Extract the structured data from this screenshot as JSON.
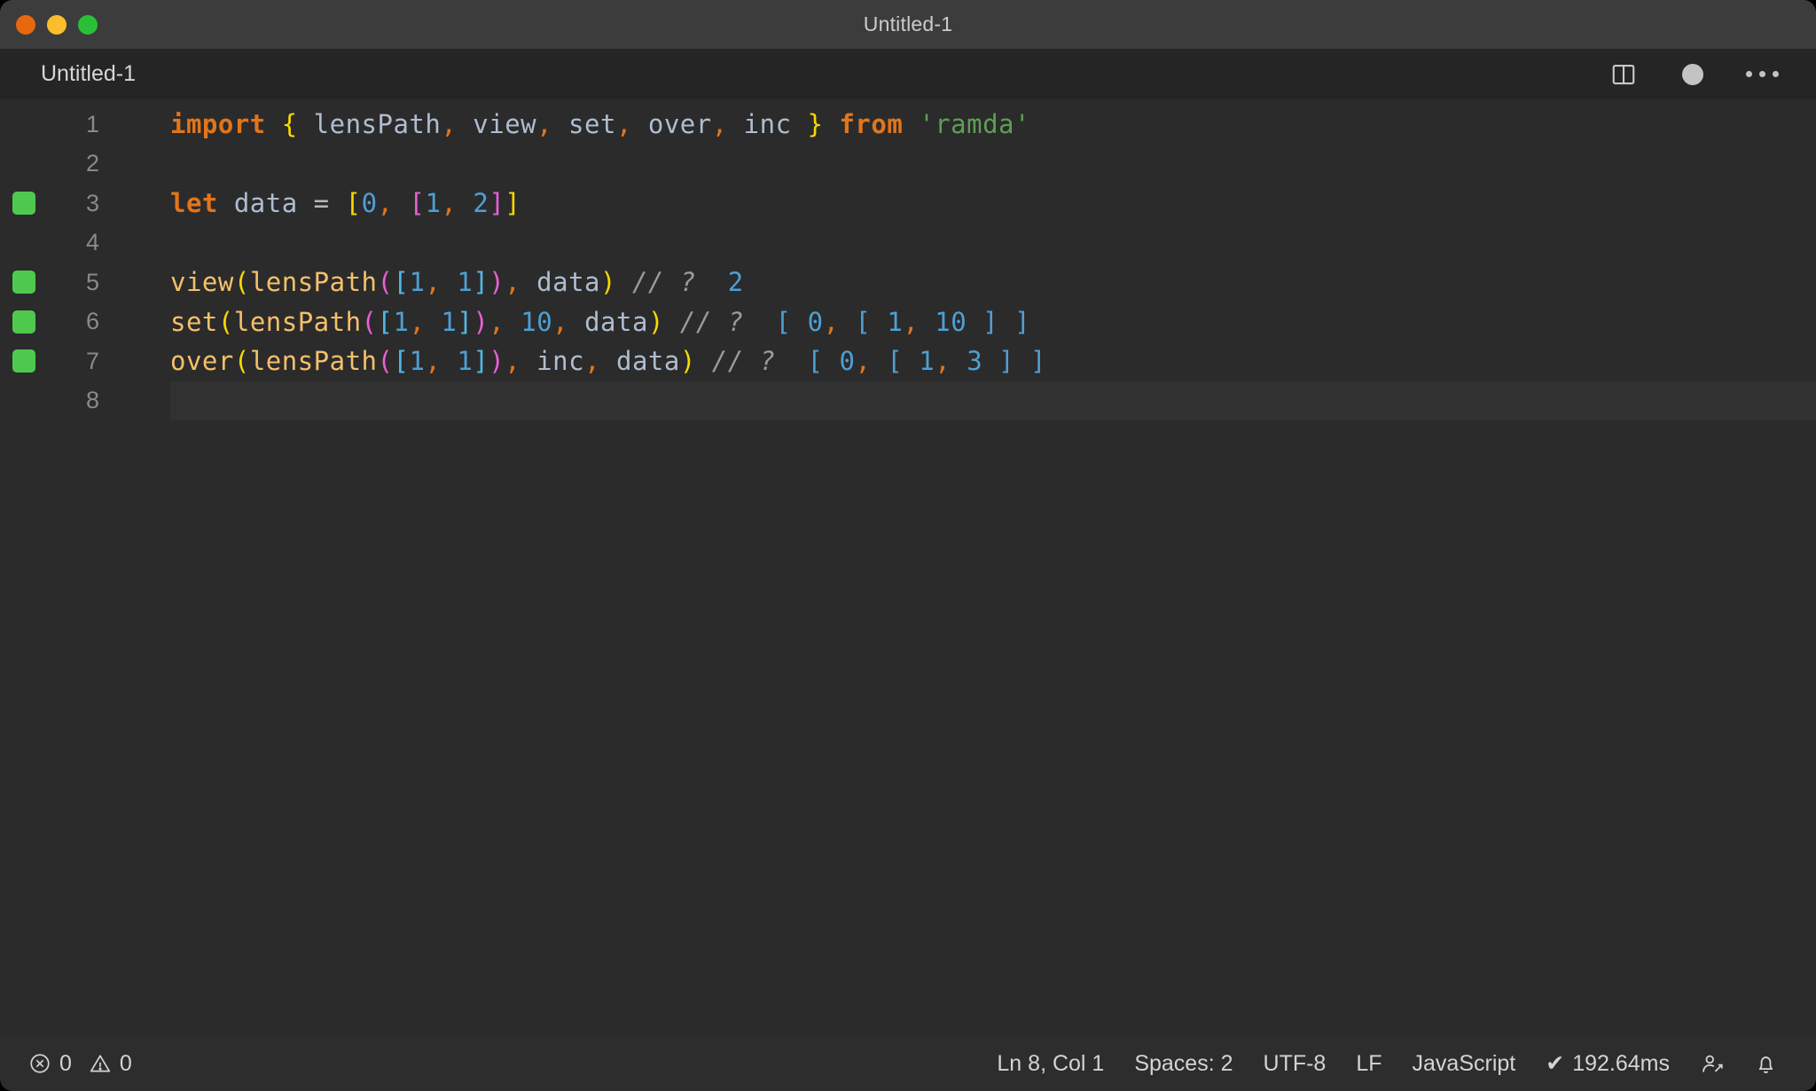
{
  "window": {
    "title": "Untitled-1",
    "traffic_lights": [
      {
        "name": "close",
        "color": "#e8680f"
      },
      {
        "name": "minimize",
        "color": "#fcbd2d"
      },
      {
        "name": "zoom",
        "color": "#2bbf37"
      }
    ]
  },
  "tab": {
    "label": "Untitled-1",
    "actions": [
      {
        "name": "split-editor-icon",
        "label": "Split Editor"
      },
      {
        "name": "unsaved-dot-icon",
        "label": "Unsaved changes"
      },
      {
        "name": "more-actions-icon",
        "label": "More Actions..."
      }
    ]
  },
  "editor": {
    "language": "JavaScript",
    "lines": [
      {
        "number": "1",
        "breakpoint": false,
        "tokens": [
          {
            "text": "import",
            "type": "kw"
          },
          {
            "text": " ",
            "type": "op"
          },
          {
            "text": "{",
            "type": "brace"
          },
          {
            "text": " lensPath",
            "type": "id"
          },
          {
            "text": ",",
            "type": "comma"
          },
          {
            "text": " view",
            "type": "id"
          },
          {
            "text": ",",
            "type": "comma"
          },
          {
            "text": " set",
            "type": "id"
          },
          {
            "text": ",",
            "type": "comma"
          },
          {
            "text": " over",
            "type": "id"
          },
          {
            "text": ",",
            "type": "comma"
          },
          {
            "text": " inc ",
            "type": "id"
          },
          {
            "text": "}",
            "type": "brace"
          },
          {
            "text": " ",
            "type": "op"
          },
          {
            "text": "from",
            "type": "kw"
          },
          {
            "text": " ",
            "type": "op"
          },
          {
            "text": "'ramda'",
            "type": "str"
          }
        ]
      },
      {
        "number": "2",
        "breakpoint": false,
        "tokens": []
      },
      {
        "number": "3",
        "breakpoint": true,
        "tokens": [
          {
            "text": "let",
            "type": "kw"
          },
          {
            "text": " data ",
            "type": "id"
          },
          {
            "text": "=",
            "type": "op"
          },
          {
            "text": " ",
            "type": "op"
          },
          {
            "text": "[",
            "type": "br1"
          },
          {
            "text": "0",
            "type": "num"
          },
          {
            "text": ",",
            "type": "comma"
          },
          {
            "text": " ",
            "type": "op"
          },
          {
            "text": "[",
            "type": "br2"
          },
          {
            "text": "1",
            "type": "num"
          },
          {
            "text": ",",
            "type": "comma"
          },
          {
            "text": " ",
            "type": "op"
          },
          {
            "text": "2",
            "type": "num"
          },
          {
            "text": "]",
            "type": "br2"
          },
          {
            "text": "]",
            "type": "br1"
          }
        ]
      },
      {
        "number": "4",
        "breakpoint": false,
        "tokens": []
      },
      {
        "number": "5",
        "breakpoint": true,
        "tokens": [
          {
            "text": "view",
            "type": "fn"
          },
          {
            "text": "(",
            "type": "br1"
          },
          {
            "text": "lensPath",
            "type": "fn"
          },
          {
            "text": "(",
            "type": "br2"
          },
          {
            "text": "[",
            "type": "br3"
          },
          {
            "text": "1",
            "type": "num"
          },
          {
            "text": ",",
            "type": "comma"
          },
          {
            "text": " ",
            "type": "op"
          },
          {
            "text": "1",
            "type": "num"
          },
          {
            "text": "]",
            "type": "br3"
          },
          {
            "text": ")",
            "type": "br2"
          },
          {
            "text": ",",
            "type": "comma"
          },
          {
            "text": " data",
            "type": "id"
          },
          {
            "text": ")",
            "type": "br1"
          },
          {
            "text": " ",
            "type": "op"
          },
          {
            "text": "// ?",
            "type": "comment"
          },
          {
            "text": "  ",
            "type": "op"
          },
          {
            "text": "2",
            "type": "num"
          }
        ]
      },
      {
        "number": "6",
        "breakpoint": true,
        "tokens": [
          {
            "text": "set",
            "type": "fn"
          },
          {
            "text": "(",
            "type": "br1"
          },
          {
            "text": "lensPath",
            "type": "fn"
          },
          {
            "text": "(",
            "type": "br2"
          },
          {
            "text": "[",
            "type": "br3"
          },
          {
            "text": "1",
            "type": "num"
          },
          {
            "text": ",",
            "type": "comma"
          },
          {
            "text": " ",
            "type": "op"
          },
          {
            "text": "1",
            "type": "num"
          },
          {
            "text": "]",
            "type": "br3"
          },
          {
            "text": ")",
            "type": "br2"
          },
          {
            "text": ",",
            "type": "comma"
          },
          {
            "text": " ",
            "type": "op"
          },
          {
            "text": "10",
            "type": "num"
          },
          {
            "text": ",",
            "type": "comma"
          },
          {
            "text": " data",
            "type": "id"
          },
          {
            "text": ")",
            "type": "br1"
          },
          {
            "text": " ",
            "type": "op"
          },
          {
            "text": "// ?",
            "type": "comment"
          },
          {
            "text": "  ",
            "type": "op"
          },
          {
            "text": "[ ",
            "type": "num"
          },
          {
            "text": "0",
            "type": "num"
          },
          {
            "text": ",",
            "type": "comma"
          },
          {
            "text": " [ ",
            "type": "num"
          },
          {
            "text": "1",
            "type": "num"
          },
          {
            "text": ",",
            "type": "comma"
          },
          {
            "text": " ",
            "type": "op"
          },
          {
            "text": "10",
            "type": "num"
          },
          {
            "text": " ] ]",
            "type": "num"
          }
        ]
      },
      {
        "number": "7",
        "breakpoint": true,
        "tokens": [
          {
            "text": "over",
            "type": "fn"
          },
          {
            "text": "(",
            "type": "br1"
          },
          {
            "text": "lensPath",
            "type": "fn"
          },
          {
            "text": "(",
            "type": "br2"
          },
          {
            "text": "[",
            "type": "br3"
          },
          {
            "text": "1",
            "type": "num"
          },
          {
            "text": ",",
            "type": "comma"
          },
          {
            "text": " ",
            "type": "op"
          },
          {
            "text": "1",
            "type": "num"
          },
          {
            "text": "]",
            "type": "br3"
          },
          {
            "text": ")",
            "type": "br2"
          },
          {
            "text": ",",
            "type": "comma"
          },
          {
            "text": " inc",
            "type": "id"
          },
          {
            "text": ",",
            "type": "comma"
          },
          {
            "text": " data",
            "type": "id"
          },
          {
            "text": ")",
            "type": "br1"
          },
          {
            "text": " ",
            "type": "op"
          },
          {
            "text": "// ?",
            "type": "comment"
          },
          {
            "text": "  ",
            "type": "op"
          },
          {
            "text": "[ ",
            "type": "num"
          },
          {
            "text": "0",
            "type": "num"
          },
          {
            "text": ",",
            "type": "comma"
          },
          {
            "text": " [ ",
            "type": "num"
          },
          {
            "text": "1",
            "type": "num"
          },
          {
            "text": ",",
            "type": "comma"
          },
          {
            "text": " ",
            "type": "op"
          },
          {
            "text": "3",
            "type": "num"
          },
          {
            "text": " ] ]",
            "type": "num"
          }
        ]
      },
      {
        "number": "8",
        "breakpoint": false,
        "current": true,
        "tokens": []
      }
    ]
  },
  "statusbar": {
    "errors": "0",
    "warnings": "0",
    "cursor": "Ln 8, Col 1",
    "indentation": "Spaces: 2",
    "encoding": "UTF-8",
    "eol": "LF",
    "language": "JavaScript",
    "runtime": "192.64ms",
    "runtime_check": "✔",
    "remote_label": "Remote",
    "bell_label": "Notifications"
  }
}
